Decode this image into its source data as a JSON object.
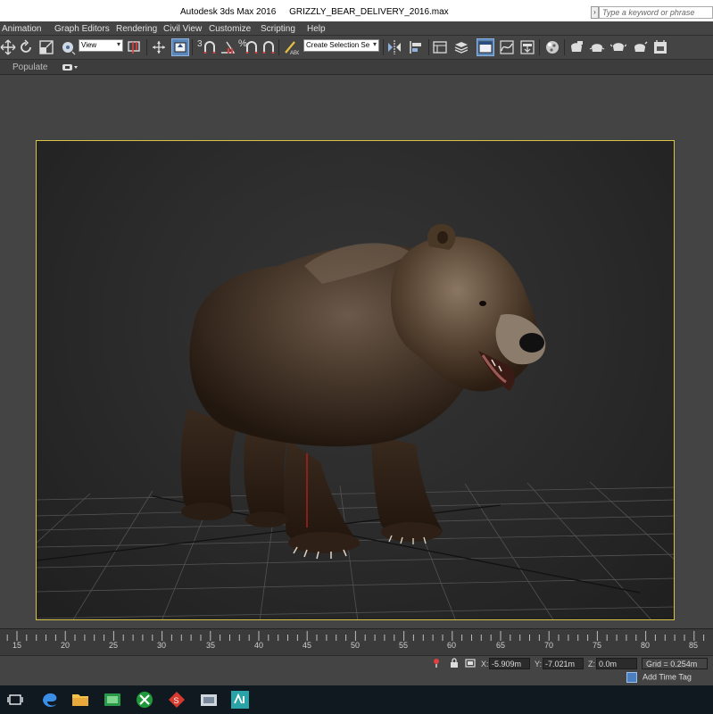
{
  "window": {
    "app_title": "Autodesk 3ds Max 2016",
    "file_title": "GRIZZLY_BEAR_DELIVERY_2016.max",
    "search_placeholder": "Type a keyword or phrase"
  },
  "menu": [
    {
      "id": "animation",
      "label": "Animation"
    },
    {
      "id": "graph-editors",
      "label": "Graph Editors"
    },
    {
      "id": "rendering",
      "label": "Rendering"
    },
    {
      "id": "civil-view",
      "label": "Civil View"
    },
    {
      "id": "customize",
      "label": "Customize"
    },
    {
      "id": "scripting",
      "label": "Scripting"
    },
    {
      "id": "help",
      "label": "Help"
    }
  ],
  "toolbar": {
    "reference_coord_value": "View",
    "selection_set_value": "Create Selection Se",
    "snap_toggle_label": "3",
    "percent_snap_label": "%",
    "icons": [
      "select-move-icon",
      "rotate-icon",
      "scale-icon",
      "pivot-icon",
      "mirror-icon",
      "align-icon",
      "layers-icon",
      "curve-editor-icon",
      "schematic-icon",
      "material-editor-icon",
      "render-setup-icon",
      "rendered-frame-icon",
      "render-icon"
    ]
  },
  "ribbon": {
    "tab_label": "Populate"
  },
  "viewport": {
    "border_color": "#d7c24a",
    "subject": "grizzly-bear-model"
  },
  "timeline": {
    "tick_labels": [
      "15",
      "20",
      "25",
      "30",
      "35",
      "40",
      "45",
      "50",
      "55",
      "60",
      "65",
      "70",
      "75",
      "80",
      "85"
    ]
  },
  "status": {
    "x_label": "X:",
    "x_value": "-5.909m",
    "y_label": "Y:",
    "y_value": "-7.021m",
    "z_label": "Z:",
    "z_value": "0.0m",
    "grid_value": "Grid = 0.254m",
    "time_tag_label": "Add Time Tag"
  },
  "taskbar": {
    "icons": [
      "task-view-icon",
      "edge-browser-icon",
      "file-explorer-icon",
      "green-app-icon",
      "xbox-icon",
      "red-app-icon",
      "photos-icon",
      "3dsmax-icon"
    ]
  },
  "colors": {
    "ui_gray": "#444444",
    "accent_blue": "#5a86b8",
    "viewport_border": "#d7c24a",
    "taskbar": "#101820"
  }
}
